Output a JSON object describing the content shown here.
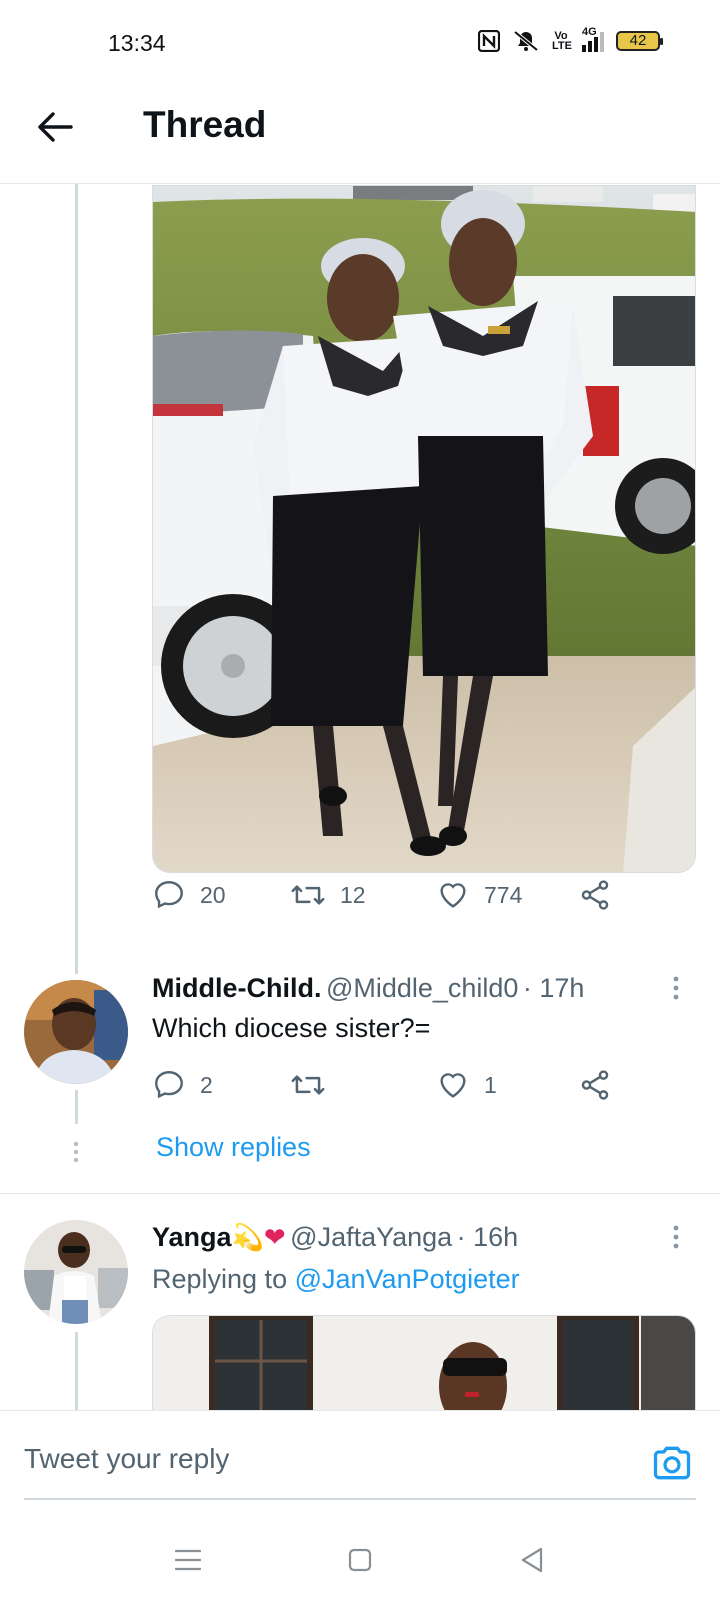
{
  "status_bar": {
    "time": "13:34",
    "battery_level": "42",
    "network_label": "4G",
    "volte_label": "Vo LTE"
  },
  "header": {
    "title": "Thread"
  },
  "main_tweet": {
    "actions": {
      "replies": "20",
      "retweets": "12",
      "likes": "774"
    }
  },
  "reply1": {
    "name": "Middle-Child.",
    "handle": "@Middle_child0",
    "time": "· 17h",
    "text": "Which diocese sister?=",
    "actions": {
      "replies": "2",
      "retweets": "",
      "likes": "1"
    },
    "show_replies": "Show replies"
  },
  "reply2": {
    "name": "Yanga",
    "emoji": "💫❤",
    "handle": "@JaftaYanga",
    "time": "· 16h",
    "replying_to_prefix": "Replying to",
    "replying_to_handle": "@JanVanPotgieter"
  },
  "reply_bar": {
    "placeholder": "Tweet your reply"
  },
  "colors": {
    "accent": "#1d9bf0",
    "text": "#0f1419",
    "muted": "#536471",
    "divider": "#e6e9ec"
  }
}
